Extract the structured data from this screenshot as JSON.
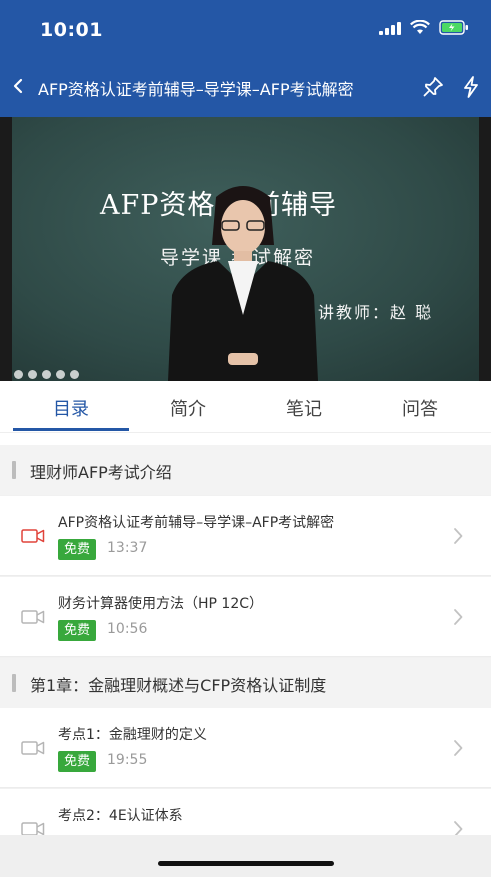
{
  "status_bar": {
    "time": "10:01"
  },
  "nav": {
    "title": "AFP资格认证考前辅导–导学课–AFP考试解密"
  },
  "video": {
    "board_line1": "AFP资格  考前辅导",
    "board_line2": "导学课        考试解密",
    "board_line3": "讲教师：赵 聪"
  },
  "tabs": [
    {
      "label": "目录"
    },
    {
      "label": "简介"
    },
    {
      "label": "笔记"
    },
    {
      "label": "问答"
    }
  ],
  "sections": [
    {
      "title": "理财师AFP考试介绍",
      "items": [
        {
          "title": "AFP资格认证考前辅导–导学课–AFP考试解密",
          "badge": "免费",
          "duration": "13:37",
          "playing": true
        },
        {
          "title": "财务计算器使用方法（HP 12C）",
          "badge": "免费",
          "duration": "10:56",
          "playing": false
        }
      ]
    },
    {
      "title": "第1章：金融理财概述与CFP资格认证制度",
      "items": [
        {
          "title": "考点1：金融理财的定义",
          "badge": "免费",
          "duration": "19:55",
          "playing": false
        },
        {
          "title": "考点2：4E认证体系",
          "badge": "",
          "duration": "",
          "playing": false
        }
      ]
    }
  ],
  "colors": {
    "brand": "#2457a6",
    "free_badge": "#38a83c",
    "playing_icon": "#e0433a",
    "idle_icon": "#b5b5b5"
  }
}
